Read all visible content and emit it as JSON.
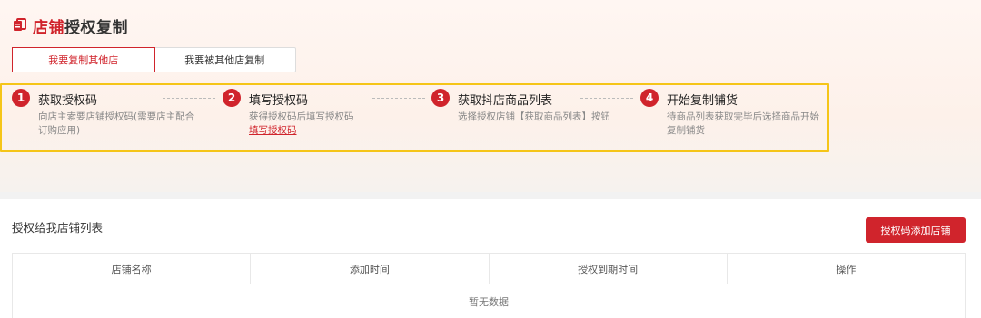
{
  "header": {
    "title_accent": "店铺",
    "title_rest": "授权复制",
    "icon": "store-copy-icon"
  },
  "tabs": [
    {
      "label": "我要复制其他店",
      "active": true
    },
    {
      "label": "我要被其他店复制",
      "active": false
    }
  ],
  "steps": [
    {
      "num": "1",
      "title": "获取授权码",
      "desc": "向店主索要店铺授权码(需要店主配合订购应用)",
      "link": ""
    },
    {
      "num": "2",
      "title": "填写授权码",
      "desc": "获得授权码后填写授权码",
      "link": "填写授权码"
    },
    {
      "num": "3",
      "title": "获取抖店商品列表",
      "desc": "选择授权店铺【获取商品列表】按钮",
      "link": ""
    },
    {
      "num": "4",
      "title": "开始复制铺货",
      "desc": "待商品列表获取完毕后选择商品开始复制铺货",
      "link": ""
    }
  ],
  "list": {
    "title": "授权给我店铺列表",
    "add_button": "授权码添加店铺",
    "columns": [
      "店铺名称",
      "添加时间",
      "授权到期时间",
      "操作"
    ],
    "empty_text": "暂无数据"
  },
  "colors": {
    "accent": "#d0242c",
    "highlight_border": "#f5c518"
  }
}
